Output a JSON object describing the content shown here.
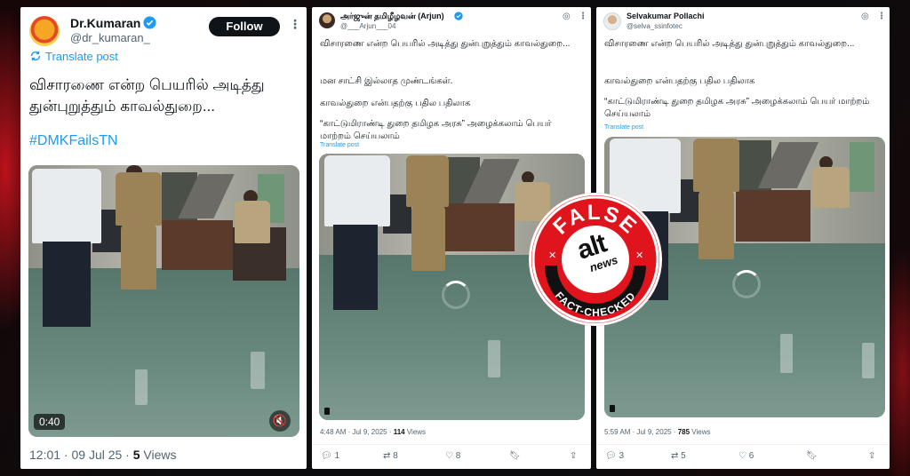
{
  "card1": {
    "display_name": "Dr.Kumaran",
    "handle": "@dr_kumaran_",
    "follow_label": "Follow",
    "translate_label": "Translate post",
    "tweet_text": "விசாரணை என்ற பெயரில் அடித்து துன்புறுத்தும் காவல்துறை...",
    "hashtag": "#DMKFailsTN",
    "video_duration": "0:40",
    "footer_time": "12:01 · 09 Jul 25 · ",
    "views_count": "5",
    "views_label": " Views"
  },
  "card2": {
    "display_name": "அர்ஜுன் தமிழீழவன் (Arjun)",
    "handle": "@___Arjun___04",
    "line1": "விசாரணை என்ற பெயரில் அடித்து துன்புறுத்தும் காவல்துறை...",
    "line2": "மன சாட்சி இல்லாத முண்டங்கள்.",
    "line3": "காவல்துறை என்பதற்கு பதில பதிலாக",
    "line4": "“காட்டுமிராண்டி துறை தமிழக அரசு” அழைக்கலாம் பெயர் மாற்றம் செய்யலாம்",
    "translate_label": "Translate post",
    "footer_time": "4:48 AM · Jul 9, 2025 · ",
    "views_count": "114",
    "views_label": " Views",
    "replies": "1",
    "reposts": "8",
    "likes": "8"
  },
  "card3": {
    "display_name": "Selvakumar Pollachi",
    "handle": "@selva_ssinfotec",
    "line1": "விசாரணை என்ற பெயரில் அடித்து துன்புறுத்தும் காவல்துறை...",
    "line2": "காவல்துறை என்பதற்கு பதில பதிலாக",
    "line3": "“காட்டுமிராண்டி துறை தமிழக அரசு” அழைக்கலாம் பெயர் மாற்றம் செய்யலாம்",
    "translate_label": "Translate post",
    "footer_time": "5:59 AM · Jul 9, 2025 · ",
    "views_count": "785",
    "views_label": " Views",
    "replies": "3",
    "reposts": "5",
    "likes": "6"
  },
  "stamp": {
    "top_text": "FALSE",
    "logo_alt": "alt",
    "logo_news": "news",
    "bottom_text": "FACT-CHECKED",
    "color": "#e0141c"
  },
  "colors": {
    "link_blue": "#1d9bf0",
    "text_dark": "#0f1419",
    "text_grey": "#536471"
  }
}
